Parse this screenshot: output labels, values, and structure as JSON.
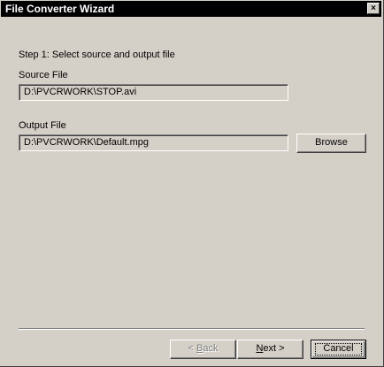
{
  "window": {
    "title": "File Converter Wizard",
    "close_glyph": "×"
  },
  "step": {
    "label": "Step 1: Select source and output file"
  },
  "source": {
    "label": "Source File",
    "value": "D:\\PVCRWORK\\STOP.avi"
  },
  "output": {
    "label": "Output File",
    "value": "D:\\PVCRWORK\\Default.mpg",
    "browse_label": "Browse"
  },
  "footer": {
    "back_prefix": "< ",
    "back_mnemonic": "B",
    "back_rest": "ack",
    "next_mnemonic": "N",
    "next_rest": "ext >",
    "cancel_label": "Cancel"
  }
}
